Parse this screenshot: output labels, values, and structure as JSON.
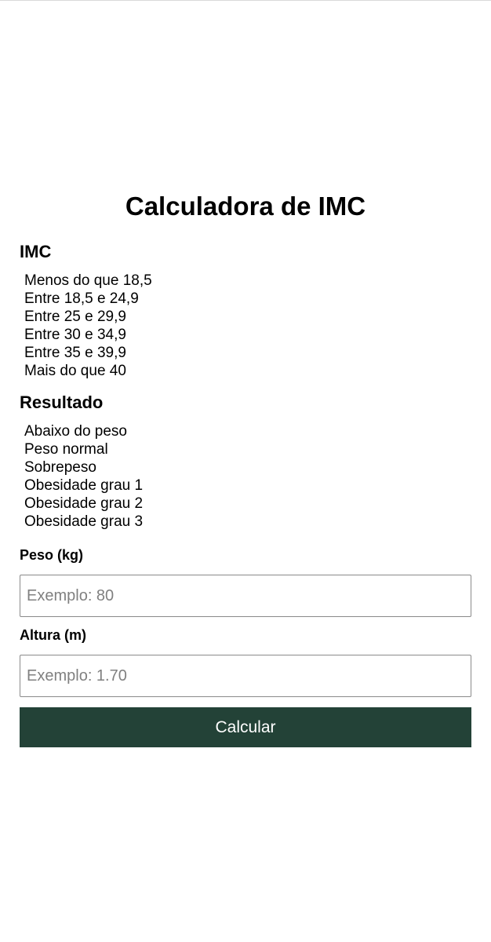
{
  "page": {
    "title": "Calculadora de IMC"
  },
  "imc_section": {
    "title": "IMC",
    "items": [
      "Menos do que 18,5",
      "Entre 18,5 e 24,9",
      "Entre 25 e 29,9",
      "Entre 30 e 34,9",
      "Entre 35 e 39,9",
      "Mais do que 40"
    ]
  },
  "result_section": {
    "title": "Resultado",
    "items": [
      "Abaixo do peso",
      "Peso normal",
      "Sobrepeso",
      "Obesidade grau 1",
      "Obesidade grau 2",
      "Obesidade grau 3"
    ]
  },
  "form": {
    "peso_label": "Peso (kg)",
    "peso_value": "",
    "peso_placeholder": "Exemplo: 80",
    "altura_label": "Altura (m)",
    "altura_value": "",
    "altura_placeholder": "Exemplo: 1.70",
    "calculate_label": "Calcular"
  },
  "colors": {
    "button_background": "#234237",
    "button_text": "#ffffff",
    "input_border": "#8a8a8a",
    "placeholder": "#808080"
  }
}
